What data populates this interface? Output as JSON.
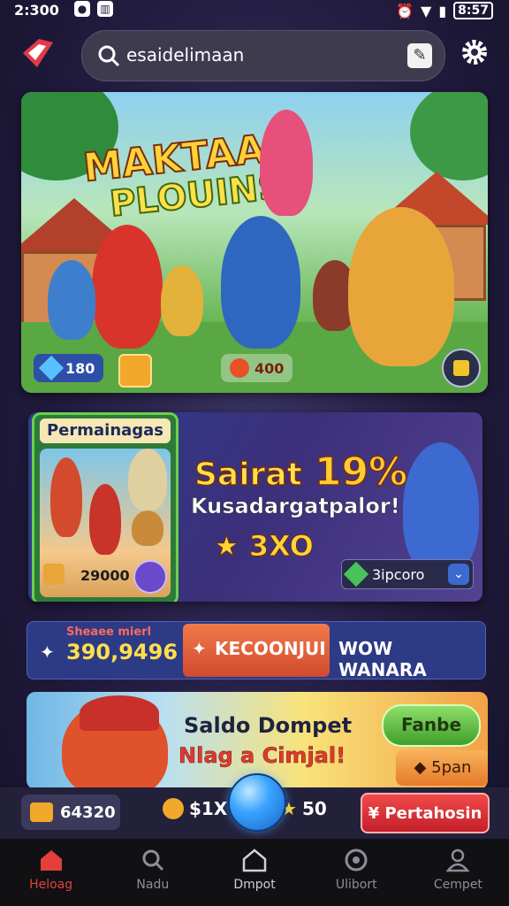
{
  "status": {
    "time": "2:300",
    "battery": "8:57"
  },
  "search": {
    "text": "esaidelimaan"
  },
  "banner": {
    "title_line1": "MAKTAA",
    "title_line2": "PLOUINS",
    "pill_left_value": "180",
    "pill_center_value": "400"
  },
  "promo": {
    "card_title": "Permainagas",
    "card_value": "29000",
    "headline": "Sairat",
    "percent": "19%",
    "subline": "Kusadargatpalor!",
    "reward": "3XO",
    "badge_text": "3ipcoro"
  },
  "ticker": {
    "label_top": "Sheaee mierl",
    "amount": "390,9496",
    "button_label": "KECOONJUI",
    "right_text": "WOW WANARA"
  },
  "wallet": {
    "title": "Saldo Dompet",
    "subtitle": "Nlag a Cimjal!",
    "green_button": "Fanbe",
    "orange_button": "5pan"
  },
  "action_bar": {
    "coins": "64320",
    "left_label": "$1X",
    "right_label": "50",
    "red_button": "Pertahosin"
  },
  "nav": {
    "items": [
      {
        "label": "Heloag",
        "icon": "home-icon",
        "active": true
      },
      {
        "label": "Nadu",
        "icon": "search-icon",
        "active": false
      },
      {
        "label": "Dmpot",
        "icon": "house-outline-icon",
        "active": false
      },
      {
        "label": "Ulibort",
        "icon": "circle-icon",
        "active": false
      },
      {
        "label": "Cempet",
        "icon": "person-icon",
        "active": false
      }
    ]
  },
  "colors": {
    "accent_red": "#e2403a",
    "nav_bg": "#111114",
    "banner_title": "#ffd23a"
  }
}
